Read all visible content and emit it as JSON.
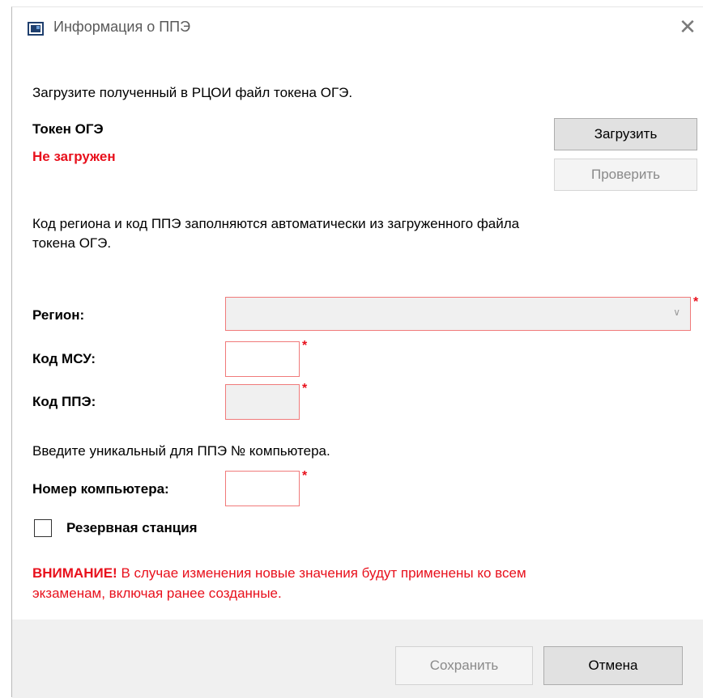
{
  "window": {
    "title": "Информация о ППЭ",
    "close_glyph": "✕"
  },
  "intro": {
    "text": "Загрузите полученный в РЦОИ файл токена ОГЭ."
  },
  "token": {
    "label": "Токен ОГЭ",
    "status": "Не загружен",
    "status_color": "#e8101c",
    "load_button": "Загрузить",
    "check_button": "Проверить"
  },
  "auto_note": {
    "line1": "Код региона и код ППЭ заполняются автоматически из загруженного файла",
    "line2": "токена ОГЭ."
  },
  "form": {
    "region_label": "Регион:",
    "region_value": "",
    "mcu_label": "Код МСУ:",
    "mcu_value": "",
    "ppe_label": "Код ППЭ:",
    "ppe_value": "",
    "required_mark": "*",
    "pc_hint": "Введите уникальный для ППЭ № компьютера.",
    "pc_label": "Номер компьютера:",
    "pc_value": "",
    "reserve_label": "Резервная станция",
    "reserve_checked": false
  },
  "warning": {
    "prefix": "ВНИМАНИЕ!",
    "line1": " В случае изменения новые значения будут применены ко всем",
    "line2": "экзаменам, включая ранее созданные."
  },
  "footer": {
    "save_button": "Сохранить",
    "cancel_button": "Отмена"
  }
}
